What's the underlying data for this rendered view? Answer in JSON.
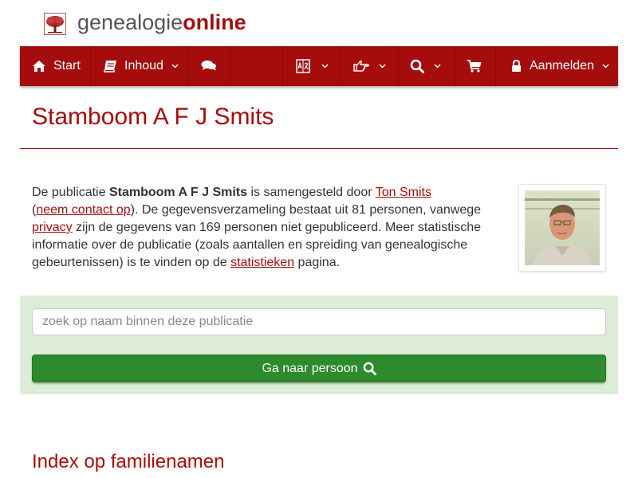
{
  "logo": {
    "part1": "genealogie",
    "part2": "online"
  },
  "nav": {
    "start": "Start",
    "inhoud": "Inhoud",
    "login": "Aanmelden"
  },
  "icons": {
    "home": "home-icon",
    "book": "book-icon",
    "comments": "comments-icon",
    "language": "language-icon",
    "hand": "hand-point-icon",
    "search": "search-icon",
    "cart": "shopping-cart-icon",
    "lock": "lock-icon",
    "chevron": "chevron-down-icon"
  },
  "page": {
    "title": "Stamboom A F J Smits"
  },
  "intro": {
    "t1": "De publicatie ",
    "pub_name": "Stamboom A F J Smits",
    "t2": " is samengesteld door ",
    "author": "Ton Smits",
    "t3": "(",
    "contact": "neem contact op",
    "t4": "). De gegevensverzameling bestaat uit 81 personen, vanwege ",
    "privacy": "privacy",
    "t5": " zijn de gegevens van 169 personen niet gepubliceerd. Meer statistische informatie over de publicatie (zoals aantallen en spreiding van genealogische gebeurtenissen) is te vinden op de ",
    "stats": "statistieken",
    "t6": " pagina."
  },
  "search": {
    "placeholder": "zoek op naam binnen deze publicatie",
    "button": "Ga naar persoon"
  },
  "section": {
    "surnames_title": "Index op familienamen"
  },
  "colors": {
    "brand": "#a50d0d",
    "panel": "#dcecd6",
    "button": "#2d8a2d"
  }
}
